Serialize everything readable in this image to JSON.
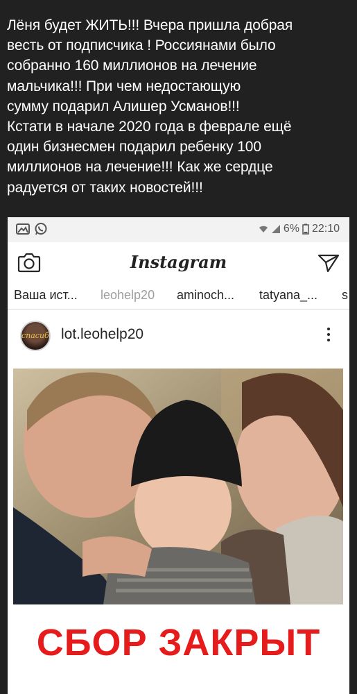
{
  "caption": {
    "lines": [
      "Лёня будет ЖИТЬ!!! Вчера пришла добрая",
      "весть от подписчика ! Россиянами было",
      "собранно 160 миллионов на лечение",
      "мальчика!!! При чем недостающую",
      "сумму подарил Алишер Усманов!!!",
      "Кстати в начале 2020 года в феврале ещё",
      "один бизнесмен подарил ребенку 100",
      "миллионов на лечение!!! Как же сердце",
      "радуется от таких новостей!!!"
    ]
  },
  "status_bar": {
    "left_icons": [
      "gallery-icon",
      "whatsapp-icon"
    ],
    "battery_percent": "6%",
    "time": "22:10"
  },
  "app_bar": {
    "logo": "Instagram",
    "left_icon": "camera-icon",
    "right_icon": "direct-send-icon"
  },
  "stories": [
    "Ваша ист...",
    "leohelp20",
    "aminoch...",
    "tatyana_...",
    "s"
  ],
  "post": {
    "username": "lot.leohelp20",
    "avatar_text": "спасибо",
    "overlay_text": "СБОР ЗАКРЫТ"
  },
  "colors": {
    "background": "#212121",
    "caption_text": "#ffffff",
    "overlay_red": "#e61b1b"
  }
}
